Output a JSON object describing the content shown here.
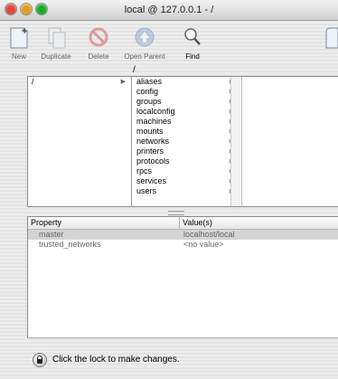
{
  "window": {
    "title": "local @ 127.0.0.1 - /",
    "traffic_lights": {
      "close": "#e0443e",
      "minimize": "#dea123",
      "zoom": "#1aab29"
    }
  },
  "toolbar": {
    "new_label": "New",
    "duplicate_label": "Duplicate",
    "delete_label": "Delete",
    "open_parent_label": "Open Parent",
    "find_label": "Find"
  },
  "browser": {
    "path": "/",
    "column1": [
      {
        "label": "/"
      }
    ],
    "column2": [
      {
        "label": "aliases"
      },
      {
        "label": "config"
      },
      {
        "label": "groups"
      },
      {
        "label": "localconfig"
      },
      {
        "label": "machines"
      },
      {
        "label": "mounts"
      },
      {
        "label": "networks"
      },
      {
        "label": "printers"
      },
      {
        "label": "protocols"
      },
      {
        "label": "rpcs"
      },
      {
        "label": "services"
      },
      {
        "label": "users"
      }
    ]
  },
  "properties": {
    "headers": {
      "property": "Property",
      "values": "Value(s)"
    },
    "rows": [
      {
        "key": "master",
        "value": "localhost/local"
      },
      {
        "key": "trusted_networks",
        "value": "<no value>"
      }
    ]
  },
  "status": {
    "message": "Click the lock to make changes."
  }
}
